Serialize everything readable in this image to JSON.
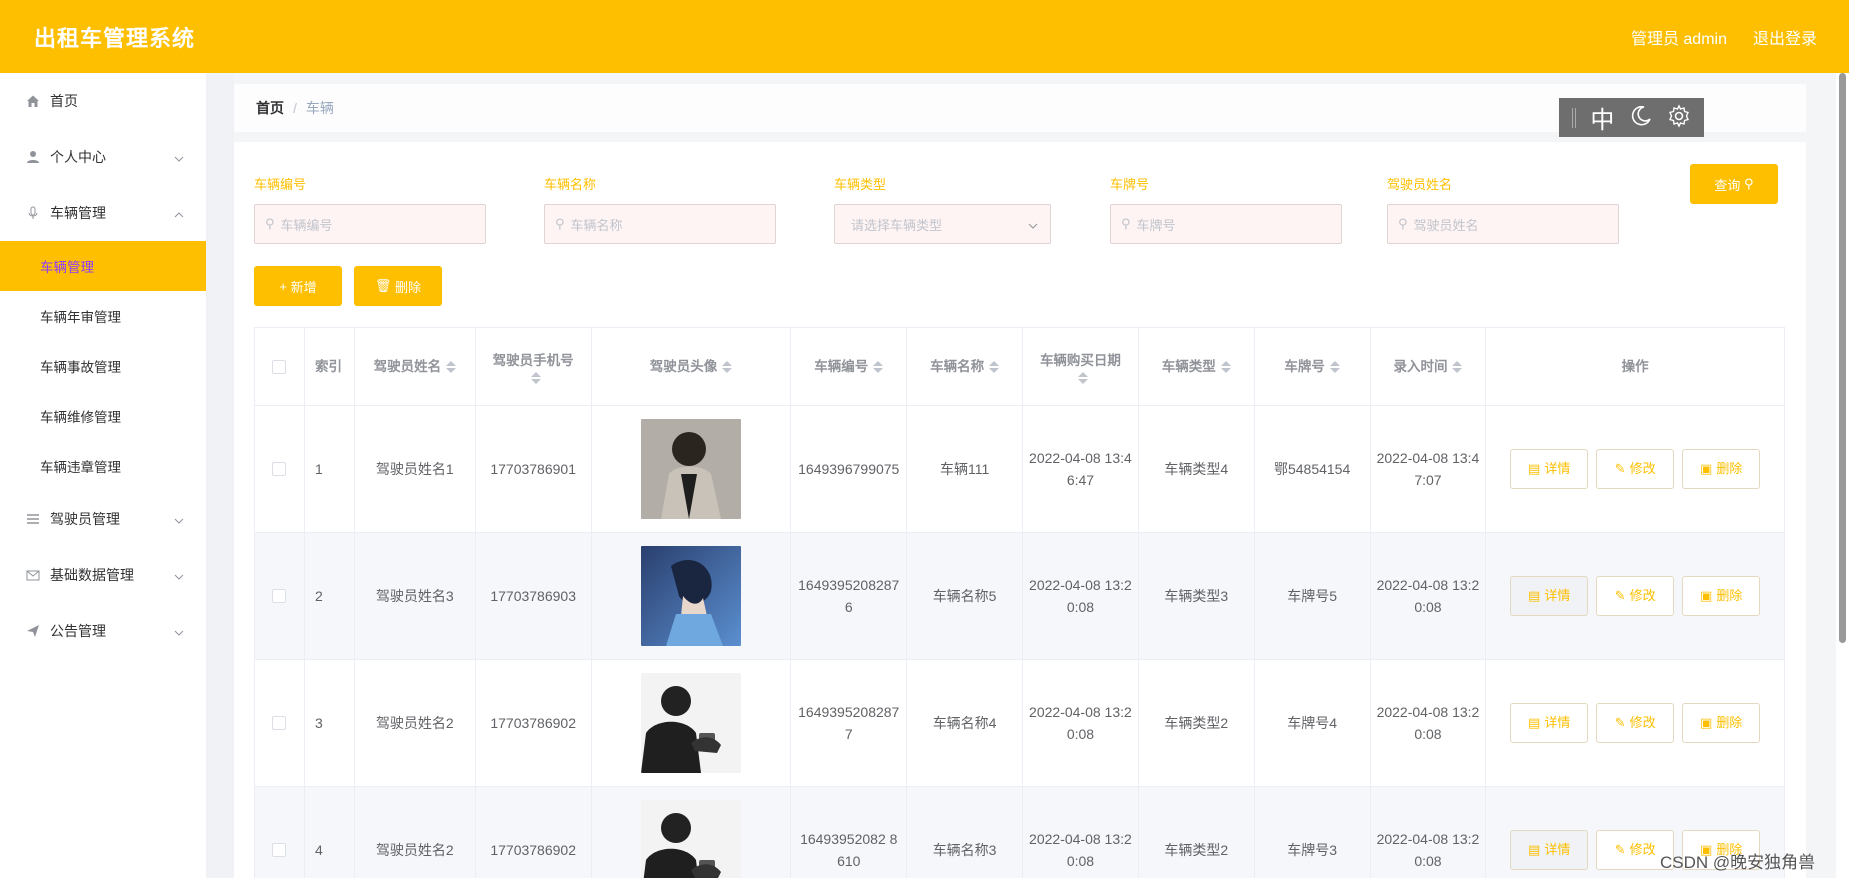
{
  "header": {
    "title": "出租车管理系统",
    "user": "管理员 admin",
    "logout": "退出登录"
  },
  "sidebar": {
    "home": "首页",
    "personal": "个人中心",
    "vehicle_mgmt": "车辆管理",
    "vehicle_sub": [
      "车辆管理",
      "车辆年审管理",
      "车辆事故管理",
      "车辆维修管理",
      "车辆违章管理"
    ],
    "driver_mgmt": "驾驶员管理",
    "basic_data": "基础数据管理",
    "notice": "公告管理"
  },
  "breadcrumb": {
    "home": "首页",
    "sep": "/",
    "current": "车辆"
  },
  "float_tools": {
    "lang": "中"
  },
  "filters": {
    "vehicle_no": {
      "label": "车辆编号",
      "placeholder": "车辆编号"
    },
    "vehicle_name": {
      "label": "车辆名称",
      "placeholder": "车辆名称"
    },
    "vehicle_type": {
      "label": "车辆类型",
      "placeholder": "请选择车辆类型"
    },
    "plate": {
      "label": "车牌号",
      "placeholder": "车牌号"
    },
    "driver_name": {
      "label": "驾驶员姓名",
      "placeholder": "驾驶员姓名"
    },
    "query": "查询"
  },
  "actions": {
    "add": "新增",
    "delete": "删除"
  },
  "table": {
    "headers": [
      "索引",
      "驾驶员姓名",
      "驾驶员手机号",
      "驾驶员头像",
      "车辆编号",
      "车辆名称",
      "车辆购买日期",
      "车辆类型",
      "车牌号",
      "录入时间",
      "操作"
    ],
    "ops": {
      "detail": "详情",
      "edit": "修改",
      "delete": "删除"
    },
    "rows": [
      {
        "index": "1",
        "driver": "驾驶员姓名1",
        "phone": "17703786901",
        "vehicle_no": "1649396799075",
        "vehicle_name": "车辆111",
        "buy_date": "2022-04-08 13:46:47",
        "type": "车辆类型4",
        "plate": "鄂54854154",
        "created": "2022-04-08 13:47:07"
      },
      {
        "index": "2",
        "driver": "驾驶员姓名3",
        "phone": "17703786903",
        "vehicle_no": "16493952082876",
        "vehicle_name": "车辆名称5",
        "buy_date": "2022-04-08 13:20:08",
        "type": "车辆类型3",
        "plate": "车牌号5",
        "created": "2022-04-08 13:20:08"
      },
      {
        "index": "3",
        "driver": "驾驶员姓名2",
        "phone": "17703786902",
        "vehicle_no": "16493952082877",
        "vehicle_name": "车辆名称4",
        "buy_date": "2022-04-08 13:20:08",
        "type": "车辆类型2",
        "plate": "车牌号4",
        "created": "2022-04-08 13:20:08"
      },
      {
        "index": "4",
        "driver": "驾驶员姓名2",
        "phone": "17703786902",
        "vehicle_no": "16493952082 8610",
        "vehicle_name": "车辆名称3",
        "buy_date": "2022-04-08 13:20:08",
        "type": "车辆类型2",
        "plate": "车牌号3",
        "created": "2022-04-08 13:20:08"
      }
    ]
  },
  "watermark": "CSDN @晚安独角兽"
}
